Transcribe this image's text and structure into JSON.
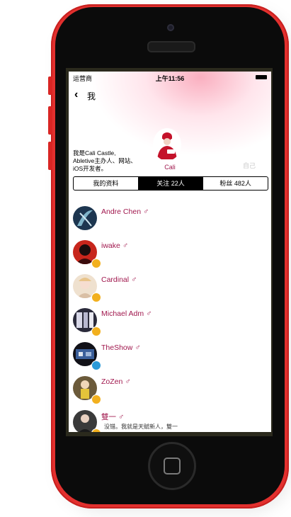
{
  "status_bar": {
    "carrier": "运营商",
    "time": "上午11:56"
  },
  "nav": {
    "back_icon": "chevron-left-icon",
    "title": "我"
  },
  "profile": {
    "bio_lines": [
      "我是Cali Castle,",
      "Abletive主办人、网站、",
      "iOS开发者。"
    ],
    "username": "Cali",
    "faded_label": "自己"
  },
  "tabs": [
    {
      "label": "我的资料"
    },
    {
      "label": "关注 22人"
    },
    {
      "label": "粉丝 482人"
    }
  ],
  "following": [
    {
      "name": "Andre Chen",
      "gender": "♂",
      "badge": "",
      "desc": ""
    },
    {
      "name": "iwake",
      "gender": "♂",
      "badge": "#f2b01e",
      "desc": ""
    },
    {
      "name": "Cardinal",
      "gender": "♂",
      "badge": "#f2b01e",
      "desc": ""
    },
    {
      "name": "Michael Adm",
      "gender": "♂",
      "badge": "#f2b01e",
      "desc": ""
    },
    {
      "name": "TheShow",
      "gender": "♂",
      "badge": "#2a9ad8",
      "desc": ""
    },
    {
      "name": "ZoZen",
      "gender": "♂",
      "badge": "#f2b01e",
      "desc": ""
    },
    {
      "name": "雙一",
      "gender": "♂",
      "badge": "#f2b01e",
      "desc": "没错。我就是天赋新人，雙一"
    }
  ],
  "colors": {
    "phone": "#e2302e",
    "accent": "#a0174d"
  }
}
